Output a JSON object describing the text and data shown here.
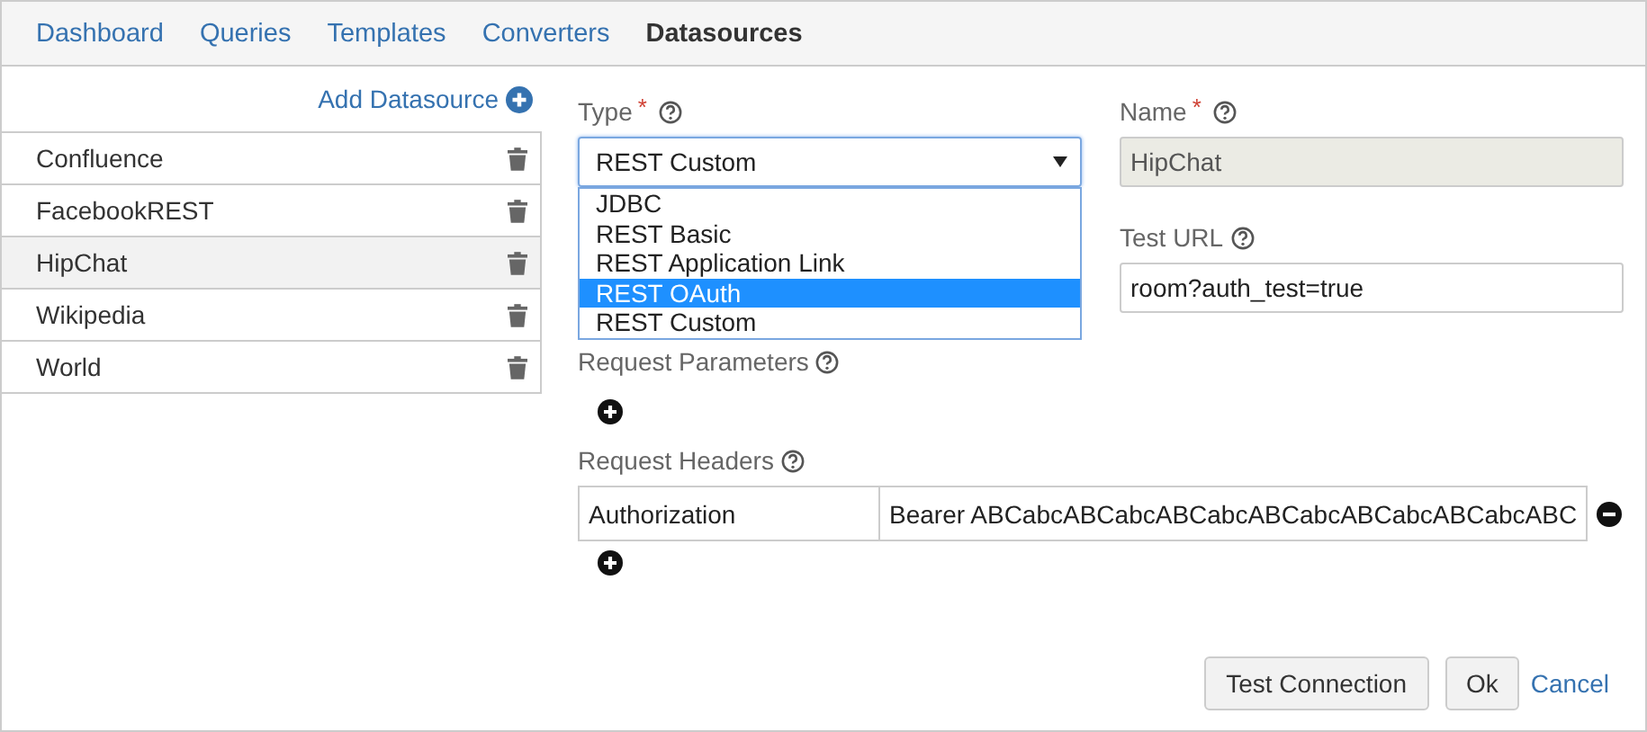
{
  "tabs": [
    {
      "label": "Dashboard",
      "selected": false
    },
    {
      "label": "Queries",
      "selected": false
    },
    {
      "label": "Templates",
      "selected": false
    },
    {
      "label": "Converters",
      "selected": false
    },
    {
      "label": "Datasources",
      "selected": true
    }
  ],
  "add_datasource": "Add Datasource",
  "datasources": [
    {
      "name": "Confluence",
      "selected": false
    },
    {
      "name": "FacebookREST",
      "selected": false
    },
    {
      "name": "HipChat",
      "selected": true
    },
    {
      "name": "Wikipedia",
      "selected": false
    },
    {
      "name": "World",
      "selected": false
    }
  ],
  "type": {
    "label": "Type",
    "required_mark": "*",
    "value": "REST Custom",
    "expanded": true,
    "options": [
      {
        "label": "JDBC",
        "highlighted": false
      },
      {
        "label": "REST Basic",
        "highlighted": false
      },
      {
        "label": "REST Application Link",
        "highlighted": false
      },
      {
        "label": "REST OAuth",
        "highlighted": true
      },
      {
        "label": "REST Custom",
        "highlighted": false
      }
    ]
  },
  "name": {
    "label": "Name",
    "required_mark": "*",
    "value": "HipChat",
    "disabled": true
  },
  "test_url": {
    "label": "Test URL",
    "value": "room?auth_test=true"
  },
  "request_parameters": {
    "label": "Request Parameters"
  },
  "request_headers": {
    "label": "Request Headers",
    "rows": [
      {
        "key": "Authorization",
        "value": "Bearer ABCabcABCabcABCabcABCabcABCabcABCabcABC"
      }
    ]
  },
  "buttons": {
    "test_connection": "Test Connection",
    "ok": "Ok",
    "cancel": "Cancel"
  }
}
